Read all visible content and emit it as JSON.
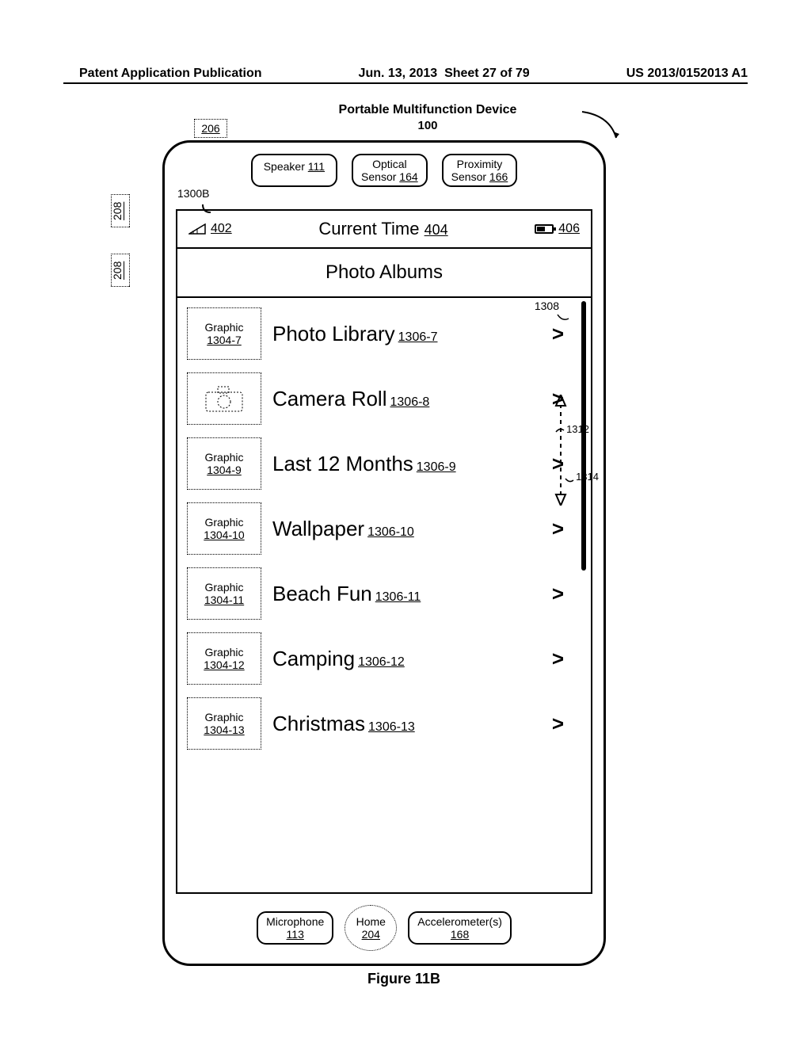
{
  "page_header": {
    "pub": "Patent Application Publication",
    "date": "Jun. 13, 2013",
    "sheet": "Sheet 27 of 79",
    "docnum": "US 2013/0152013 A1"
  },
  "figure": {
    "device_title": "Portable Multifunction Device",
    "device_num": "100",
    "ref_206": "206",
    "ref_208": "208",
    "ref_1300b": "1300B",
    "caption": "Figure 11B",
    "top_sensors": {
      "speaker_label": "Speaker",
      "speaker_num": "111",
      "optical_l1": "Optical",
      "optical_l2": "Sensor",
      "optical_num": "164",
      "prox_l1": "Proximity",
      "prox_l2": "Sensor",
      "prox_num": "166"
    },
    "status": {
      "signal_ref": "402",
      "time_label": "Current Time",
      "time_ref": "404",
      "battery_ref": "406"
    },
    "albums_header": "Photo Albums",
    "annotations": {
      "ref_1308": "1308",
      "ref_1312": "1312",
      "ref_1314": "1314"
    },
    "rows": [
      {
        "thumb_label": "Graphic",
        "thumb_ref": "1304-7",
        "name": "Photo Library",
        "name_ref": "1306-7"
      },
      {
        "thumb_label": "",
        "thumb_ref": "",
        "name": "Camera Roll",
        "name_ref": "1306-8",
        "camera": true
      },
      {
        "thumb_label": "Graphic",
        "thumb_ref": "1304-9",
        "name": "Last 12 Months",
        "name_ref": "1306-9"
      },
      {
        "thumb_label": "Graphic",
        "thumb_ref": "1304-10",
        "name": "Wallpaper",
        "name_ref": "1306-10"
      },
      {
        "thumb_label": "Graphic",
        "thumb_ref": "1304-11",
        "name": "Beach Fun",
        "name_ref": "1306-11"
      },
      {
        "thumb_label": "Graphic",
        "thumb_ref": "1304-12",
        "name": "Camping",
        "name_ref": "1306-12"
      },
      {
        "thumb_label": "Graphic",
        "thumb_ref": "1304-13",
        "name": "Christmas",
        "name_ref": "1306-13"
      }
    ],
    "bottom": {
      "mic_label": "Microphone",
      "mic_ref": "113",
      "home_label": "Home",
      "home_ref": "204",
      "accel_label": "Accelerometer(s)",
      "accel_ref": "168"
    }
  }
}
